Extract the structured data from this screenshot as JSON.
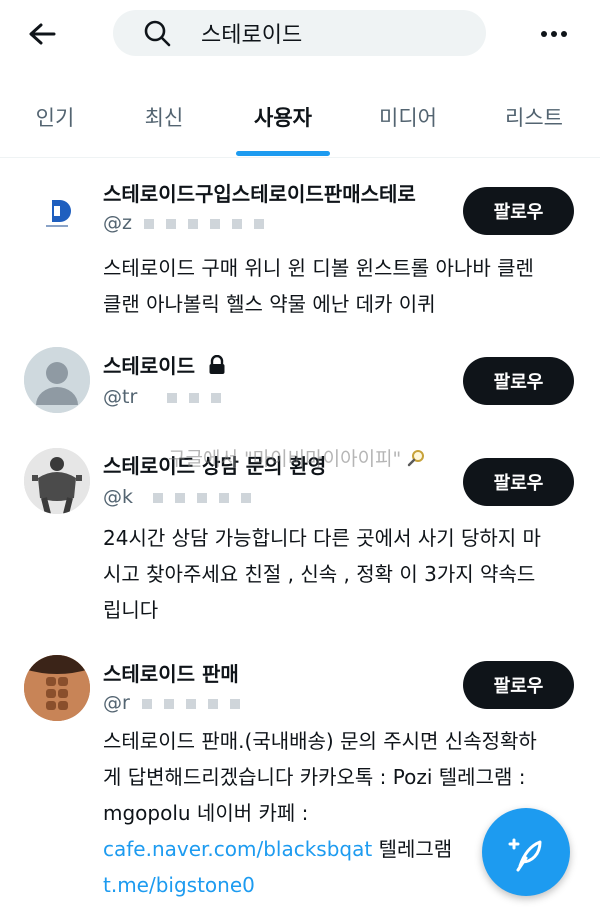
{
  "search": {
    "query": "스테로이드"
  },
  "tabs": [
    {
      "label": "인기",
      "active": false
    },
    {
      "label": "최신",
      "active": false
    },
    {
      "label": "사용자",
      "active": true
    },
    {
      "label": "미디어",
      "active": false
    },
    {
      "label": "리스트",
      "active": false
    }
  ],
  "users": [
    {
      "name": "스테로이드구입스테로이드판매스테로",
      "handle": "@z",
      "follow_label": "팔로우",
      "bio_lines": [
        "스테로이드 구매 위니 윈 디볼 윈스트롤 아나바 클렌",
        "클랜 아나볼릭 헬스 약물 에난 데카 이퀴"
      ]
    },
    {
      "name": "스테로이드",
      "handle": "@tr",
      "follow_label": "팔로우",
      "bio_lines": []
    },
    {
      "name": "스테로이드 상담 문의 환영",
      "handle": "@k",
      "follow_label": "팔로우",
      "bio_lines": [
        "24시간 상담 가능합니다 다른 곳에서 사기 당하지 마",
        "시고 찾아주세요 친절 , 신속 , 정확 이 3가지 약속드",
        "립니다"
      ]
    },
    {
      "name": "스테로이드 판매",
      "handle": "@r",
      "follow_label": "팔로우",
      "bio_lines": [
        "스테로이드 판매.(국내배송) 문의 주시면 신속정확하",
        "게 답변해드리겠습니다 카카오톡 : Pozi 텔레그램 :",
        "mgopolu 네이버 카페 :"
      ],
      "bio_link1": "cafe.naver.com/blacksbqat",
      "bio_after_link1": " 텔레그램",
      "bio_link2": "t.me/bigstone0"
    }
  ],
  "watermark": "구글에서 \"마이비마이아이피\"",
  "colors": {
    "accent": "#1d9bf0",
    "text": "#0f1419",
    "secondary": "#536471",
    "button": "#0f1419"
  },
  "icons": {
    "back": "arrow-left-icon",
    "search": "search-icon",
    "more": "more-icon",
    "lock": "lock-icon",
    "compose": "feather-icon"
  }
}
